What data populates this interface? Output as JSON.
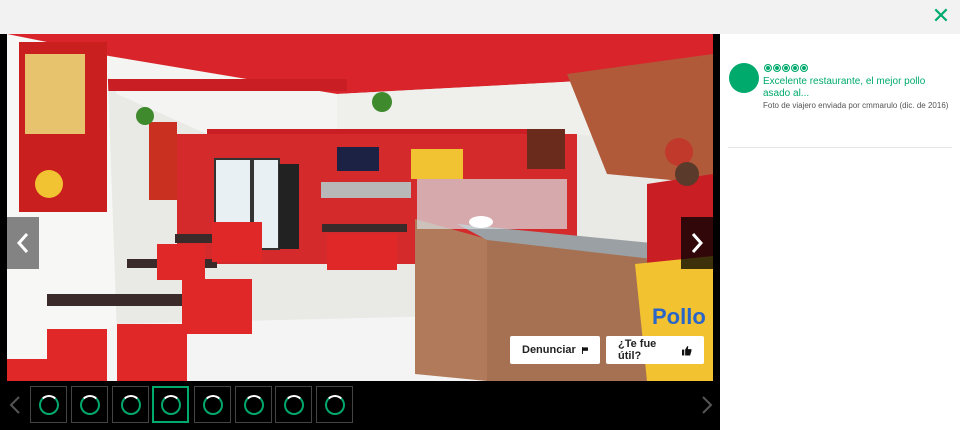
{
  "header": {
    "close_icon": "close-icon",
    "close_glyph": "✕"
  },
  "viewer": {
    "photo_alt": "Foto de viajero",
    "prev_icon": "chevron-left-icon",
    "next_icon": "chevron-right-icon",
    "report_label": "Denunciar",
    "report_icon": "flag-icon",
    "helpful_label": "¿Te fue útil?",
    "helpful_icon": "thumbs-up-icon"
  },
  "thumbnails": {
    "count": 8,
    "active_index": 3,
    "loading_icon": "loading-spinner-icon"
  },
  "sidebar": {
    "rating": 5,
    "rating_max": 5,
    "review_title": "Excelente restaurante, el mejor pollo asado al...",
    "credit_prefix": "Foto de viajero enviada por ",
    "credit_user": "cmmarulo",
    "credit_date": " (dic. de 2016)"
  },
  "colors": {
    "accent": "#00aa6c",
    "topbar": "#f2f2f2",
    "viewer_bg": "#000000"
  }
}
